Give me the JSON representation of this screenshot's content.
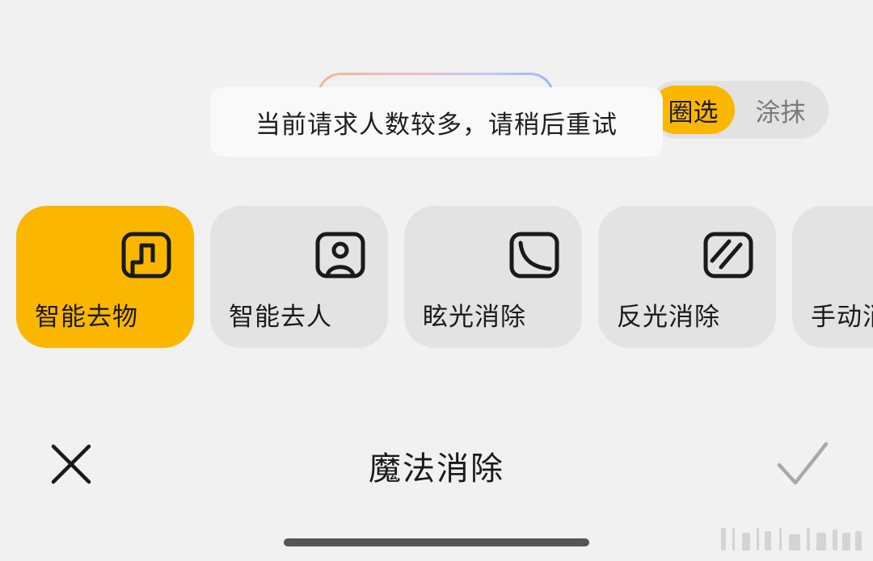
{
  "mode_toggle": {
    "active_label": "圈选",
    "inactive_label": "涂抹"
  },
  "toast": {
    "message": "当前请求人数较多，请稍后重试"
  },
  "tools": [
    {
      "label": "智能去物",
      "icon": "object-removal-icon",
      "selected": true
    },
    {
      "label": "智能去人",
      "icon": "person-removal-icon",
      "selected": false
    },
    {
      "label": "眩光消除",
      "icon": "glare-removal-icon",
      "selected": false
    },
    {
      "label": "反光消除",
      "icon": "reflection-removal-icon",
      "selected": false
    },
    {
      "label": "手动消",
      "icon": "manual-removal-icon",
      "selected": false
    }
  ],
  "bottom_bar": {
    "title": "魔法消除",
    "close_icon": "close-icon",
    "confirm_icon": "checkmark-icon"
  },
  "colors": {
    "accent": "#fbb700",
    "background": "#f1f1f1",
    "card": "#e3e3e3"
  }
}
